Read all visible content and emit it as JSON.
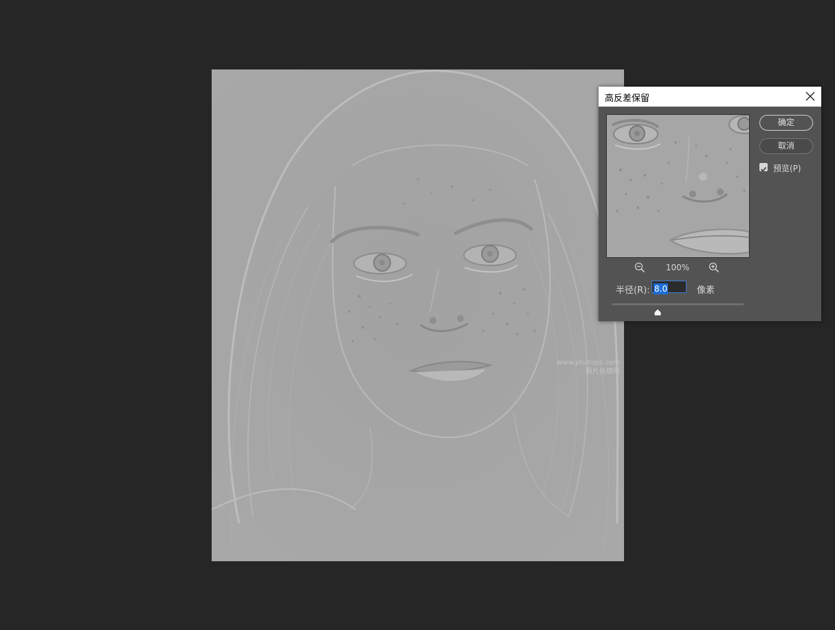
{
  "dialog": {
    "title": "高反差保留",
    "ok_label": "确定",
    "cancel_label": "取消",
    "preview_label": "预览(P)",
    "preview_checked": true,
    "zoom_level": "100%",
    "radius_label": "半径(R):",
    "radius_value": "8.0",
    "radius_unit": "像素",
    "slider_value_fraction": 0.35
  },
  "canvas": {
    "watermark_line1": "www.photops.com",
    "watermark_line2": "照片处理网"
  },
  "icons": {
    "close": "close-icon",
    "zoom_out": "zoom-out-icon",
    "zoom_in": "zoom-in-icon",
    "checkbox": "checkmark-icon",
    "slider": "slider-thumb-icon"
  },
  "colors": {
    "workspace_bg": "#262626",
    "dialog_bg": "#535353",
    "highpass_gray": "#a4a4a4",
    "selection_blue": "#1e6fd6"
  }
}
